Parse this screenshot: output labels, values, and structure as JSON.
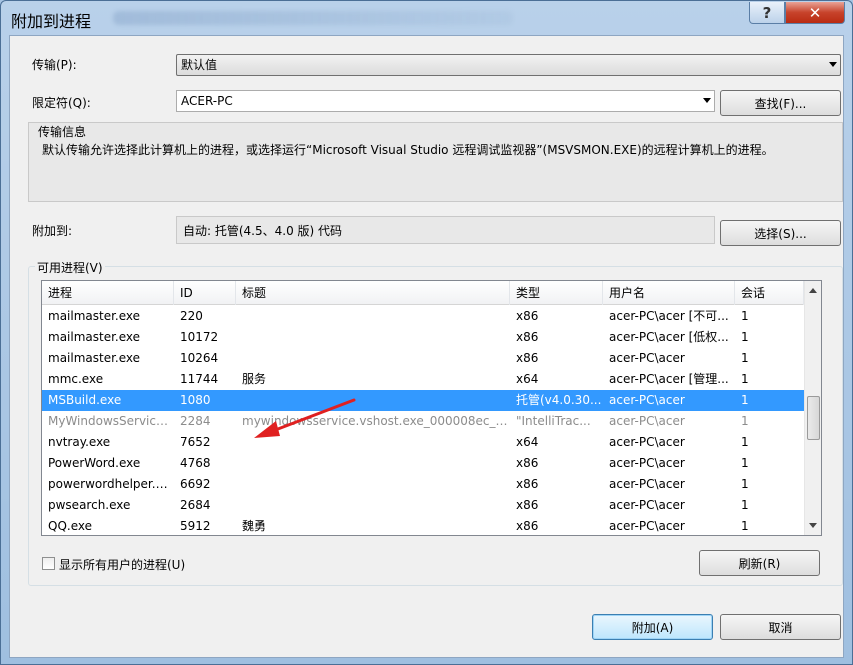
{
  "window": {
    "title": "附加到进程",
    "help_label": "?",
    "close_label": "✕"
  },
  "transport": {
    "label": "传输(P):",
    "value": "默认值"
  },
  "qualifier": {
    "label": "限定符(Q):",
    "value": "ACER-PC",
    "find_button": "查找(F)..."
  },
  "transport_info": {
    "title": "传输信息",
    "text": "默认传输允许选择此计算机上的进程，或选择运行“Microsoft Visual Studio 远程调试监视器”(MSVSMON.EXE)的远程计算机上的进程。"
  },
  "attach_to": {
    "label": "附加到:",
    "value": "自动: 托管(4.5、4.0 版) 代码",
    "select_button": "选择(S)..."
  },
  "processes": {
    "title": "可用进程(V)",
    "columns": [
      "进程",
      "ID",
      "标题",
      "类型",
      "用户名",
      "会话"
    ],
    "rows": [
      [
        "mailmaster.exe",
        "220",
        "",
        "x86",
        "acer-PC\\acer [不可...",
        "1"
      ],
      [
        "mailmaster.exe",
        "10172",
        "",
        "x86",
        "acer-PC\\acer [低权...",
        "1"
      ],
      [
        "mailmaster.exe",
        "10264",
        "",
        "x86",
        "acer-PC\\acer",
        "1"
      ],
      [
        "mmc.exe",
        "11744",
        "服务",
        "x64",
        "acer-PC\\acer [管理...",
        "1"
      ],
      [
        "MSBuild.exe",
        "1080",
        "",
        "托管(v4.0.30...",
        "acer-PC\\acer",
        "1"
      ],
      [
        "MyWindowsService....",
        "2284",
        "mywindowsservice.vshost.exe_000008ec_01...",
        "\"IntelliTrac...",
        "acer-PC\\acer",
        "1"
      ],
      [
        "nvtray.exe",
        "7652",
        "",
        "x64",
        "acer-PC\\acer",
        "1"
      ],
      [
        "PowerWord.exe",
        "4768",
        "",
        "x86",
        "acer-PC\\acer",
        "1"
      ],
      [
        "powerwordhelper.e...",
        "6692",
        "",
        "x86",
        "acer-PC\\acer",
        "1"
      ],
      [
        "pwsearch.exe",
        "2684",
        "",
        "x86",
        "acer-PC\\acer",
        "1"
      ],
      [
        "QQ.exe",
        "5912",
        "魏勇",
        "x86",
        "acer-PC\\acer",
        "1"
      ]
    ],
    "selected_index": 4,
    "dim_index": 5
  },
  "show_all_users": {
    "label": "显示所有用户的进程(U)",
    "checked": false
  },
  "refresh_button": "刷新(R)",
  "attach_button": "附加(A)",
  "cancel_button": "取消",
  "colors": {
    "selection": "#3399ff",
    "annotation_arrow": "#e02020"
  }
}
